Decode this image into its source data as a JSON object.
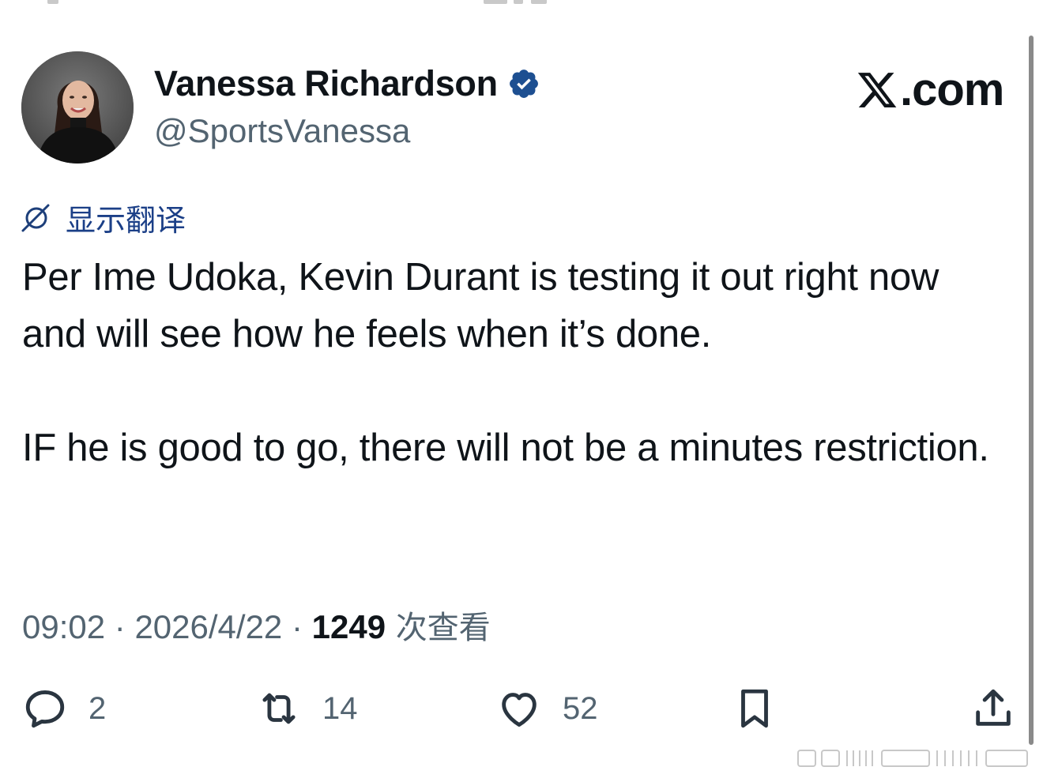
{
  "author": {
    "display_name": "Vanessa Richardson",
    "handle": "@SportsVanessa",
    "verified": true
  },
  "brand": {
    "logo_icon": "x-logo-icon",
    "label": ".com"
  },
  "translate": {
    "icon": "translate-globe-icon",
    "label": "显示翻译"
  },
  "tweet": {
    "paragraphs": [
      "Per Ime Udoka, Kevin Durant is testing it out right now and will see how he feels when it’s done.",
      "IF he is good to go, there will not be a minutes restriction."
    ]
  },
  "meta": {
    "time": "09:02",
    "separator": " · ",
    "date": "2026/4/22",
    "views_count": "1249",
    "views_label": " 次查看"
  },
  "actions": {
    "reply": {
      "icon": "reply-icon",
      "count": "2"
    },
    "repost": {
      "icon": "repost-icon",
      "count": "14"
    },
    "like": {
      "icon": "heart-icon",
      "count": "52"
    },
    "bookmark": {
      "icon": "bookmark-icon"
    },
    "share": {
      "icon": "share-icon"
    }
  },
  "colors": {
    "text_primary": "#0f1419",
    "text_secondary": "#536471",
    "verified_blue": "#1d4f91",
    "translate_blue": "#1b3f87"
  }
}
